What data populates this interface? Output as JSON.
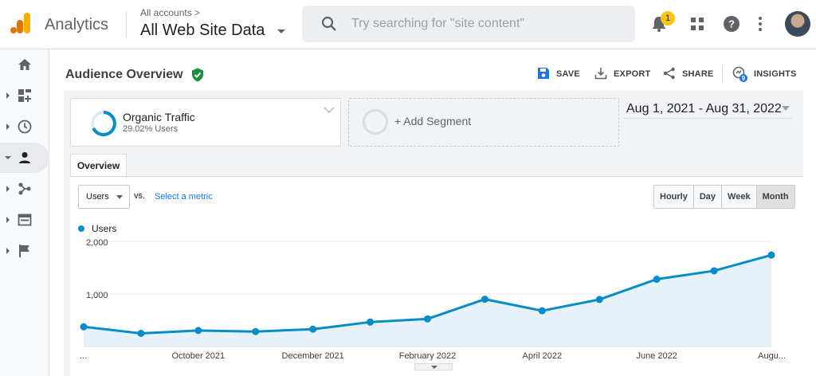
{
  "header": {
    "app_name": "Analytics",
    "account_label": "All accounts",
    "account_chevron": ">",
    "property": "All Web Site Data",
    "search_placeholder": "Try searching for \"site content\"",
    "notification_count": "1",
    "logo_colors": [
      "#f9ab00",
      "#e37400"
    ]
  },
  "sidebar": {
    "items": [
      {
        "icon": "home-icon"
      },
      {
        "icon": "customization-icon"
      },
      {
        "icon": "realtime-clock-icon"
      },
      {
        "icon": "audience-person-icon",
        "active": true
      },
      {
        "icon": "acquisition-icon"
      },
      {
        "icon": "behavior-icon"
      },
      {
        "icon": "conversions-flag-icon"
      }
    ]
  },
  "report": {
    "title": "Audience Overview",
    "actions": {
      "save": "SAVE",
      "export": "EXPORT",
      "share": "SHARE",
      "insights": "INSIGHTS"
    },
    "insights_badge": "9"
  },
  "segments": {
    "active": {
      "name": "Organic Traffic",
      "subtitle": "29.02% Users"
    },
    "add_label": "+ Add Segment"
  },
  "date_range": "Aug 1, 2021 - Aug 31, 2022",
  "tabs": {
    "overview": "Overview"
  },
  "controls": {
    "metric": "Users",
    "vs": "vs.",
    "select_metric": "Select a metric",
    "granularity": [
      "Hourly",
      "Day",
      "Week",
      "Month"
    ],
    "selected_granularity": "Month"
  },
  "colors": {
    "accent": "#058dc7",
    "link": "#1a73e8",
    "verified": "#1e8e3e"
  },
  "chart_data": {
    "type": "area",
    "series": [
      {
        "name": "Users",
        "values": [
          375,
          250,
          305,
          285,
          330,
          465,
          525,
          900,
          680,
          895,
          1280,
          1440,
          1740
        ]
      }
    ],
    "x": [
      "Aug 2021",
      "Sep 2021",
      "Oct 2021",
      "Nov 2021",
      "Dec 2021",
      "Jan 2022",
      "Feb 2022",
      "Mar 2022",
      "Apr 2022",
      "May 2022",
      "Jun 2022",
      "Jul 2022",
      "Aug 2022"
    ],
    "tick_labels": [
      "...",
      "October 2021",
      "December 2021",
      "February 2022",
      "April 2022",
      "June 2022",
      "Augu..."
    ],
    "y_ticks": [
      "1,000",
      "2,000"
    ],
    "ylim": [
      0,
      2000
    ],
    "grid": true,
    "legend": "top-left"
  }
}
